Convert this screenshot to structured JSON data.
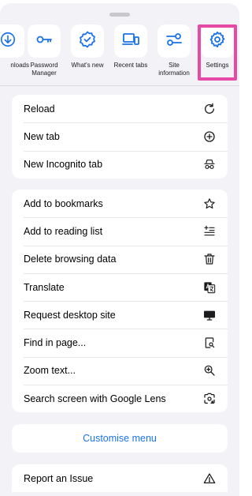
{
  "destinations": [
    {
      "label": "nloads",
      "icon": "download-icon"
    },
    {
      "label": "Password\nManager",
      "icon": "key-icon"
    },
    {
      "label": "What's new",
      "icon": "new-badge-icon"
    },
    {
      "label": "Recent tabs",
      "icon": "devices-icon"
    },
    {
      "label": "Site\ninformation",
      "icon": "sliders-icon"
    },
    {
      "label": "Settings",
      "icon": "gear-icon"
    }
  ],
  "group1": [
    {
      "label": "Reload",
      "icon": "reload-icon"
    },
    {
      "label": "New tab",
      "icon": "plus-circle-icon"
    },
    {
      "label": "New Incognito tab",
      "icon": "incognito-icon"
    }
  ],
  "group2": [
    {
      "label": "Add to bookmarks",
      "icon": "star-icon"
    },
    {
      "label": "Add to reading list",
      "icon": "reading-list-icon"
    },
    {
      "label": "Delete browsing data",
      "icon": "trash-icon"
    },
    {
      "label": "Translate",
      "icon": "translate-icon"
    },
    {
      "label": "Request desktop site",
      "icon": "desktop-icon"
    },
    {
      "label": "Find in page...",
      "icon": "find-in-page-icon"
    },
    {
      "label": "Zoom text...",
      "icon": "zoom-in-icon"
    },
    {
      "label": "Search screen with Google Lens",
      "icon": "lens-icon"
    }
  ],
  "customise": {
    "label": "Customise menu"
  },
  "group3": [
    {
      "label": "Report an Issue",
      "icon": "warning-icon"
    }
  ],
  "colors": {
    "accent": "#1a73e8",
    "highlight": "#e64aa6",
    "background": "#f2f2f7",
    "icon": "#1c1c1e"
  }
}
